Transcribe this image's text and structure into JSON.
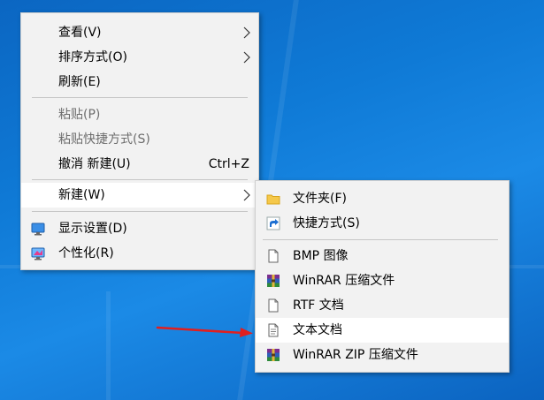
{
  "desktop_menu": {
    "items": [
      {
        "label": "查看(V)"
      },
      {
        "label": "排序方式(O)"
      },
      {
        "label": "刷新(E)"
      },
      {
        "label": "粘贴(P)"
      },
      {
        "label": "粘贴快捷方式(S)"
      },
      {
        "label": "撤消 新建(U)",
        "shortcut": "Ctrl+Z"
      },
      {
        "label": "新建(W)"
      },
      {
        "label": "显示设置(D)"
      },
      {
        "label": "个性化(R)"
      }
    ]
  },
  "new_submenu": {
    "items": [
      {
        "label": "文件夹(F)",
        "icon": "folder-icon"
      },
      {
        "label": "快捷方式(S)",
        "icon": "shortcut-icon"
      },
      {
        "label": "BMP 图像",
        "icon": "bmp-image-icon"
      },
      {
        "label": "WinRAR 压缩文件",
        "icon": "winrar-icon"
      },
      {
        "label": "RTF 文档",
        "icon": "rtf-document-icon"
      },
      {
        "label": "文本文档",
        "icon": "text-document-icon"
      },
      {
        "label": "WinRAR ZIP 压缩文件",
        "icon": "winrar-zip-icon"
      }
    ]
  },
  "colors": {
    "desktop": "#0f7ad6",
    "menu_bg": "#f2f2f2",
    "highlight": "#ffffff",
    "annotation_arrow": "#e01f1f"
  }
}
